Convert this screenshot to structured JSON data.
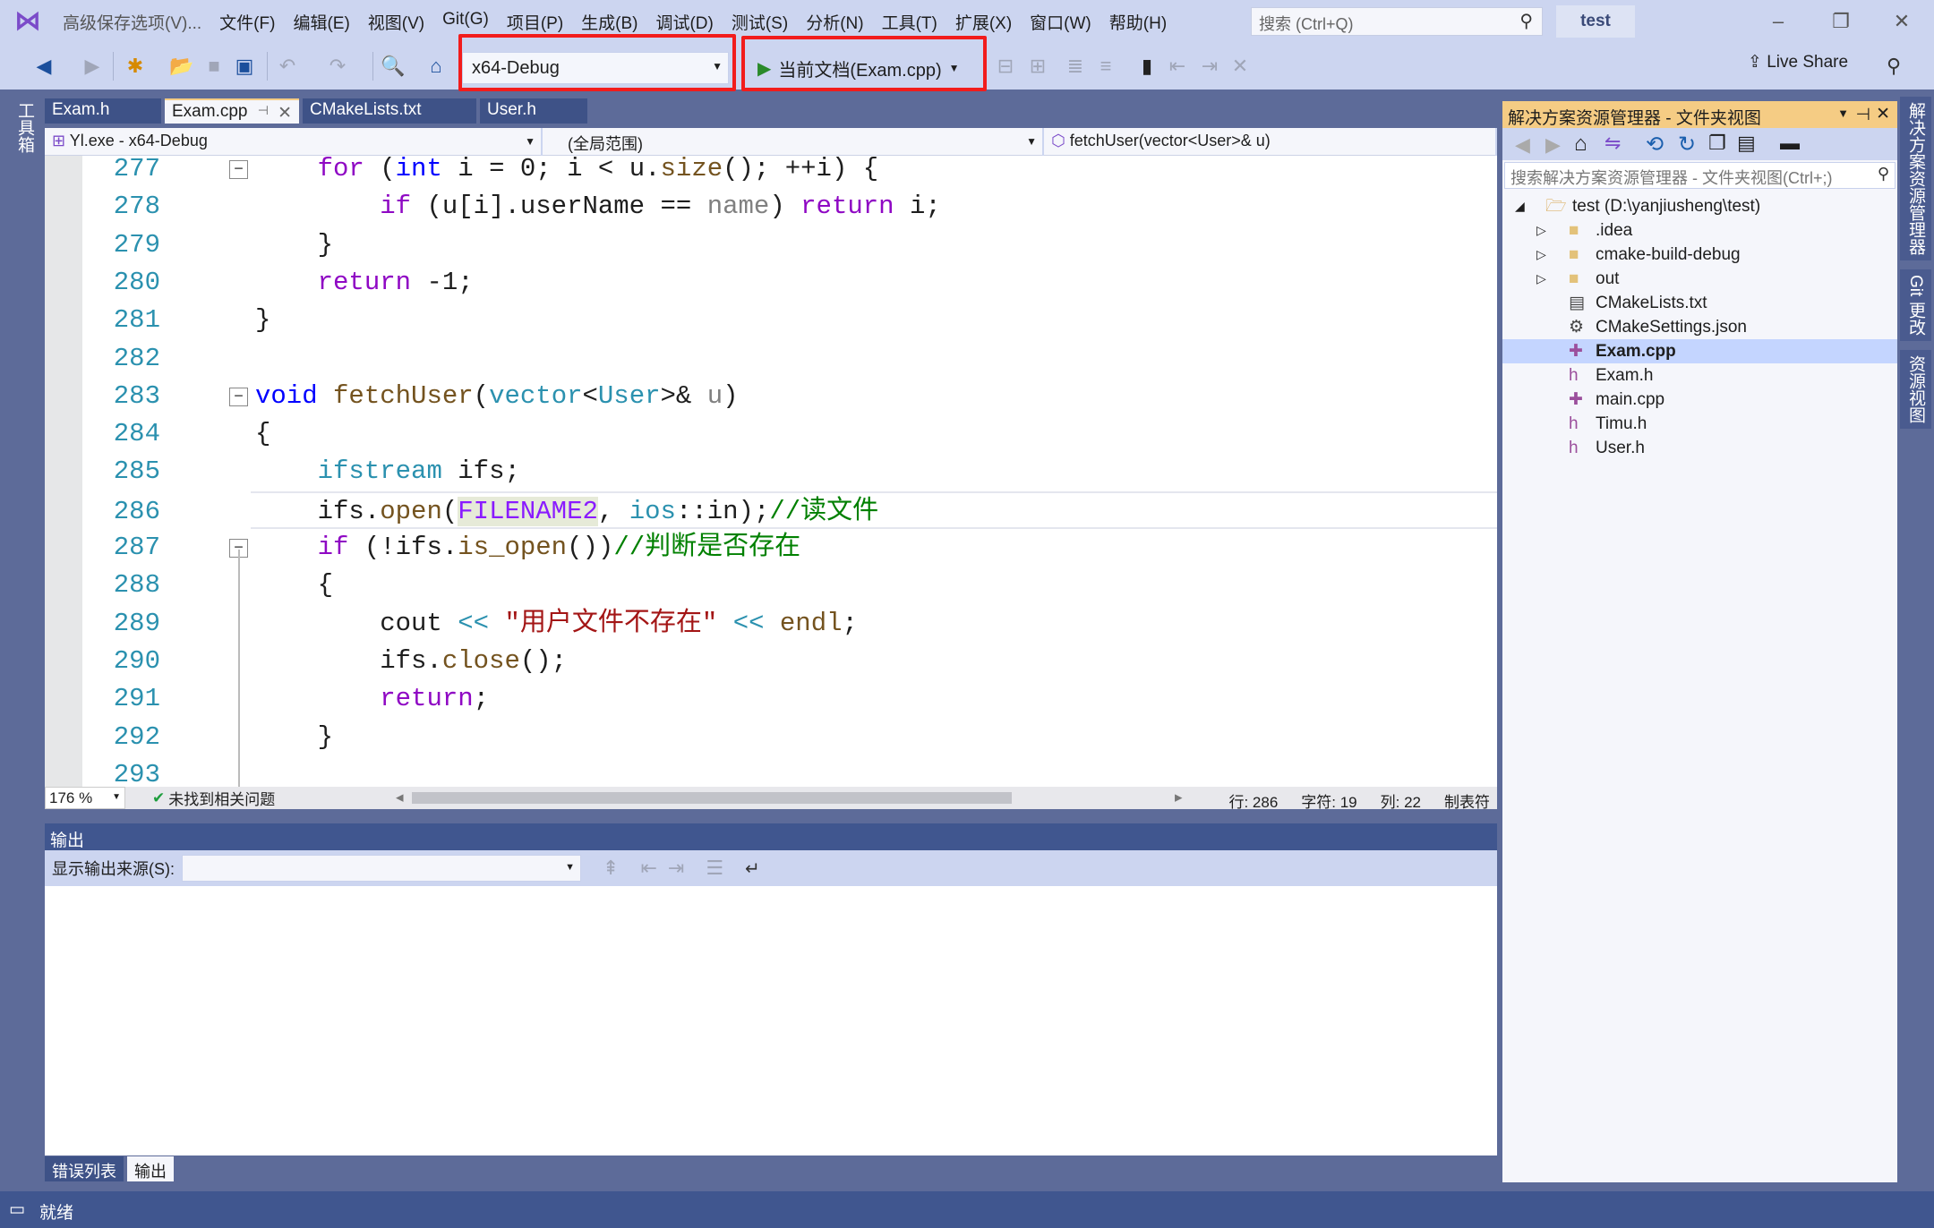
{
  "window": {
    "save_options": "高级保存选项(V)...",
    "solution_name": "test",
    "search_placeholder": "搜索 (Ctrl+Q)"
  },
  "menu": [
    "文件(F)",
    "编辑(E)",
    "视图(V)",
    "Git(G)",
    "项目(P)",
    "生成(B)",
    "调试(D)",
    "测试(S)",
    "分析(N)",
    "工具(T)",
    "扩展(X)",
    "窗口(W)",
    "帮助(H)"
  ],
  "toolbar": {
    "config": "x64-Debug",
    "run_target": "当前文档(Exam.cpp)",
    "live_share": "Live Share",
    "highlight_color": "#f21c1c"
  },
  "tabs": [
    "Exam.h",
    "Exam.cpp",
    "CMakeLists.txt",
    "User.h"
  ],
  "active_tab": "Exam.cpp",
  "nav": {
    "project": "Yl.exe - x64-Debug",
    "scope": "(全局范围)",
    "member": "fetchUser(vector<User>& u)"
  },
  "code": [
    {
      "n": "277",
      "fold": true,
      "t": [
        [
          "    ",
          "pl"
        ],
        [
          "for",
          "kw"
        ],
        [
          " (",
          "pl"
        ],
        [
          "int",
          "kb"
        ],
        [
          " i = 0; i < u.",
          "pl"
        ],
        [
          "size",
          "fn"
        ],
        [
          "(); ++i) {",
          "pl"
        ]
      ]
    },
    {
      "n": "278",
      "t": [
        [
          "        ",
          "pl"
        ],
        [
          "if",
          "kw"
        ],
        [
          " (u[i].userName == ",
          "pl"
        ],
        [
          "name",
          "pm"
        ],
        [
          ") ",
          "pl"
        ],
        [
          "return",
          "kw"
        ],
        [
          " i;",
          "pl"
        ]
      ]
    },
    {
      "n": "279",
      "t": [
        [
          "    }",
          "pl"
        ]
      ]
    },
    {
      "n": "280",
      "t": [
        [
          "    ",
          "pl"
        ],
        [
          "return",
          "kw"
        ],
        [
          " -1;",
          "pl"
        ]
      ]
    },
    {
      "n": "281",
      "t": [
        [
          "}",
          "pl"
        ]
      ]
    },
    {
      "n": "282",
      "t": []
    },
    {
      "n": "283",
      "fold": true,
      "t": [
        [
          "void",
          "kb"
        ],
        [
          " ",
          "pl"
        ],
        [
          "fetchUser",
          "fn"
        ],
        [
          "(",
          "pl"
        ],
        [
          "vector",
          "ty"
        ],
        [
          "<",
          "pl"
        ],
        [
          "User",
          "ty"
        ],
        [
          ">& ",
          "pl"
        ],
        [
          "u",
          "pm"
        ],
        [
          ")",
          "pl"
        ]
      ]
    },
    {
      "n": "284",
      "t": [
        [
          "{",
          "pl"
        ]
      ]
    },
    {
      "n": "285",
      "t": [
        [
          "    ",
          "pl"
        ],
        [
          "ifstream",
          "ty"
        ],
        [
          " ifs;",
          "pl"
        ]
      ]
    },
    {
      "n": "286",
      "cur": true,
      "t": [
        [
          "    ifs.",
          "pl"
        ],
        [
          "open",
          "fn"
        ],
        [
          "(",
          "pl"
        ],
        [
          "FILENAME2",
          "mc"
        ],
        [
          ", ",
          "pl"
        ],
        [
          "ios",
          "ty"
        ],
        [
          "::in);",
          "pl"
        ],
        [
          "//读文件",
          "cm"
        ]
      ]
    },
    {
      "n": "287",
      "fold": true,
      "t": [
        [
          "    ",
          "pl"
        ],
        [
          "if",
          "kw"
        ],
        [
          " (!ifs.",
          "pl"
        ],
        [
          "is_open",
          "fn"
        ],
        [
          "())",
          "pl"
        ],
        [
          "//判断是否存在",
          "cm"
        ]
      ]
    },
    {
      "n": "288",
      "t": [
        [
          "    {",
          "pl"
        ]
      ]
    },
    {
      "n": "289",
      "t": [
        [
          "        cout ",
          "pl"
        ],
        [
          "<<",
          "ty"
        ],
        [
          " ",
          "pl"
        ],
        [
          "\"用户文件不存在\"",
          "st"
        ],
        [
          " ",
          "pl"
        ],
        [
          "<<",
          "ty"
        ],
        [
          " ",
          "pl"
        ],
        [
          "endl",
          "fn"
        ],
        [
          ";",
          "pl"
        ]
      ]
    },
    {
      "n": "290",
      "t": [
        [
          "        ifs.",
          "pl"
        ],
        [
          "close",
          "fn"
        ],
        [
          "();",
          "pl"
        ]
      ]
    },
    {
      "n": "291",
      "t": [
        [
          "        ",
          "pl"
        ],
        [
          "return",
          "kw"
        ],
        [
          ";",
          "pl"
        ]
      ]
    },
    {
      "n": "292",
      "t": [
        [
          "    }",
          "pl"
        ]
      ]
    },
    {
      "n": "293",
      "t": []
    }
  ],
  "editor_status": {
    "zoom": "176 %",
    "issues": "未找到相关问题",
    "line": "行: 286",
    "char": "字符: 19",
    "col": "列: 22",
    "tabs": "制表符"
  },
  "output": {
    "title": "输出",
    "source_label": "显示输出来源(S):",
    "source_value": ""
  },
  "bottom_tabs": [
    "错误列表",
    "输出"
  ],
  "status": {
    "text": "就绪"
  },
  "solution_explorer": {
    "title": "解决方案资源管理器 - 文件夹视图",
    "search_placeholder": "搜索解决方案资源管理器 - 文件夹视图(Ctrl+;)",
    "items": [
      {
        "label": "test (D:\\yanjiusheng\\test)",
        "level": 0,
        "icon": "folder-open-icon",
        "expander": "expanded"
      },
      {
        "label": ".idea",
        "level": 1,
        "icon": "folder-icon",
        "expander": "collapsed"
      },
      {
        "label": "cmake-build-debug",
        "level": 1,
        "icon": "folder-icon",
        "expander": "collapsed"
      },
      {
        "label": "out",
        "level": 1,
        "icon": "folder-icon",
        "expander": "collapsed"
      },
      {
        "label": "CMakeLists.txt",
        "level": 1,
        "icon": "text-file-icon"
      },
      {
        "label": "CMakeSettings.json",
        "level": 1,
        "icon": "settings-file-icon"
      },
      {
        "label": "Exam.cpp",
        "level": 1,
        "icon": "cpp-file-icon",
        "selected": true
      },
      {
        "label": "Exam.h",
        "level": 1,
        "icon": "header-file-icon"
      },
      {
        "label": "main.cpp",
        "level": 1,
        "icon": "cpp-file-icon"
      },
      {
        "label": "Timu.h",
        "level": 1,
        "icon": "header-file-icon"
      },
      {
        "label": "User.h",
        "level": 1,
        "icon": "header-file-icon"
      }
    ]
  },
  "side_tabs": {
    "left": "工具箱",
    "right": [
      "解决方案资源管理器",
      "Git 更改",
      "资源视图"
    ]
  }
}
